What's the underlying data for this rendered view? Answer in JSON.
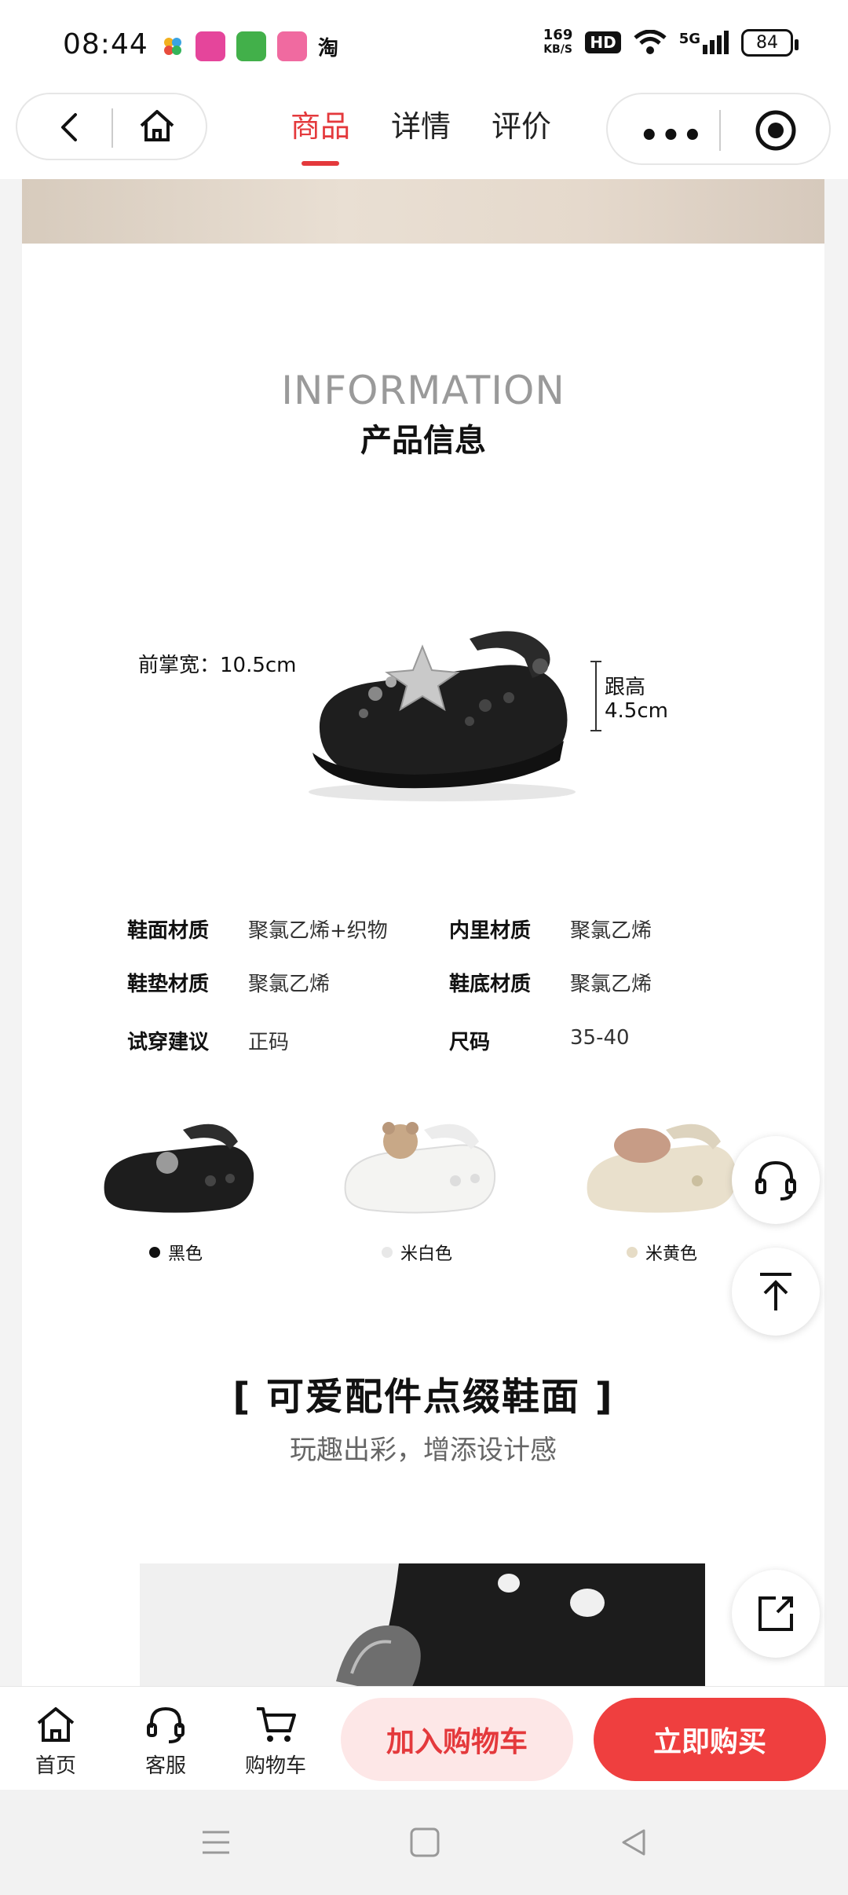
{
  "status_bar": {
    "time": "08:44",
    "taobao_glyph": "淘",
    "net_speed_value": "169",
    "net_speed_unit": "KB/S",
    "hd": "HD",
    "network": "5G",
    "battery": "84"
  },
  "nav": {
    "tabs": [
      {
        "label": "商品",
        "active": true
      },
      {
        "label": "详情",
        "active": false
      },
      {
        "label": "评价",
        "active": false
      }
    ],
    "more_glyph": "•••"
  },
  "content": {
    "info_title_en": "INFORMATION",
    "info_title_cn": "产品信息",
    "forefoot_width": "前掌宽：10.5cm",
    "heel_height_label": "跟高",
    "heel_height_value": "4.5cm",
    "specs": [
      {
        "key": "鞋面材质",
        "value": "聚氯乙烯+织物"
      },
      {
        "key": "内里材质",
        "value": "聚氯乙烯"
      },
      {
        "key": "鞋垫材质",
        "value": "聚氯乙烯"
      },
      {
        "key": "鞋底材质",
        "value": "聚氯乙烯"
      },
      {
        "key": "试穿建议",
        "value": "正码"
      },
      {
        "key": "尺码",
        "value": "35-40"
      }
    ],
    "variants": [
      {
        "label": "黑色",
        "dot_color": "#111111"
      },
      {
        "label": "米白色",
        "dot_color": "#e8e8e8"
      },
      {
        "label": "米黄色",
        "dot_color": "#e6dcc6"
      }
    ],
    "feature_title": "[ 可爱配件点缀鞋面 ]",
    "feature_subtitle": "玩趣出彩，增添设计感"
  },
  "bottom_bar": {
    "home": "首页",
    "service": "客服",
    "cart": "购物车",
    "add_to_cart": "加入购物车",
    "buy_now": "立即购买"
  },
  "colors": {
    "accent": "#e4393c",
    "buy_button": "#ef3f3f",
    "cart_button_bg": "#fde7e7"
  }
}
